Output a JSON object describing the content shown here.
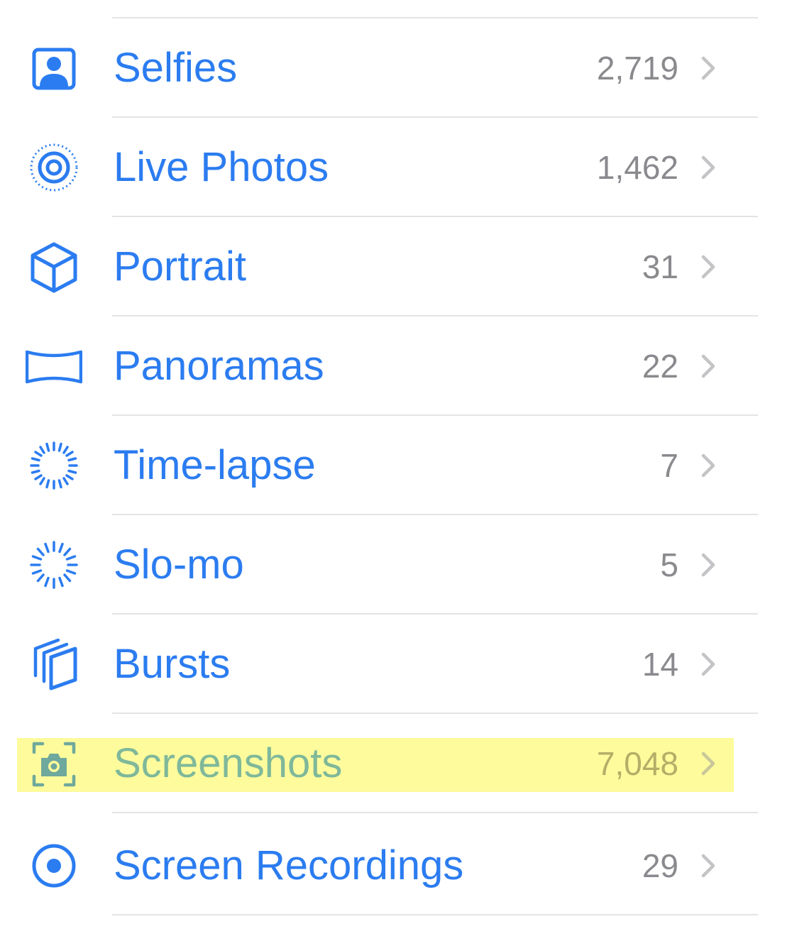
{
  "colors": {
    "accent": "#2b7cf0",
    "count_gray": "#8a8a8e",
    "separator": "#e4e4e7",
    "highlight": "#fdfb9c"
  },
  "items": [
    {
      "label": "Selfies",
      "count": "2,719",
      "icon": "selfie-icon"
    },
    {
      "label": "Live Photos",
      "count": "1,462",
      "icon": "live-photo-icon"
    },
    {
      "label": "Portrait",
      "count": "31",
      "icon": "cube-icon"
    },
    {
      "label": "Panoramas",
      "count": "22",
      "icon": "panorama-icon"
    },
    {
      "label": "Time-lapse",
      "count": "7",
      "icon": "timelapse-icon"
    },
    {
      "label": "Slo-mo",
      "count": "5",
      "icon": "slomo-icon"
    },
    {
      "label": "Bursts",
      "count": "14",
      "icon": "bursts-icon"
    },
    {
      "label": "Screenshots",
      "count": "7,048",
      "icon": "screenshot-icon",
      "highlighted": true
    },
    {
      "label": "Screen Recordings",
      "count": "29",
      "icon": "screen-recording-icon"
    }
  ]
}
